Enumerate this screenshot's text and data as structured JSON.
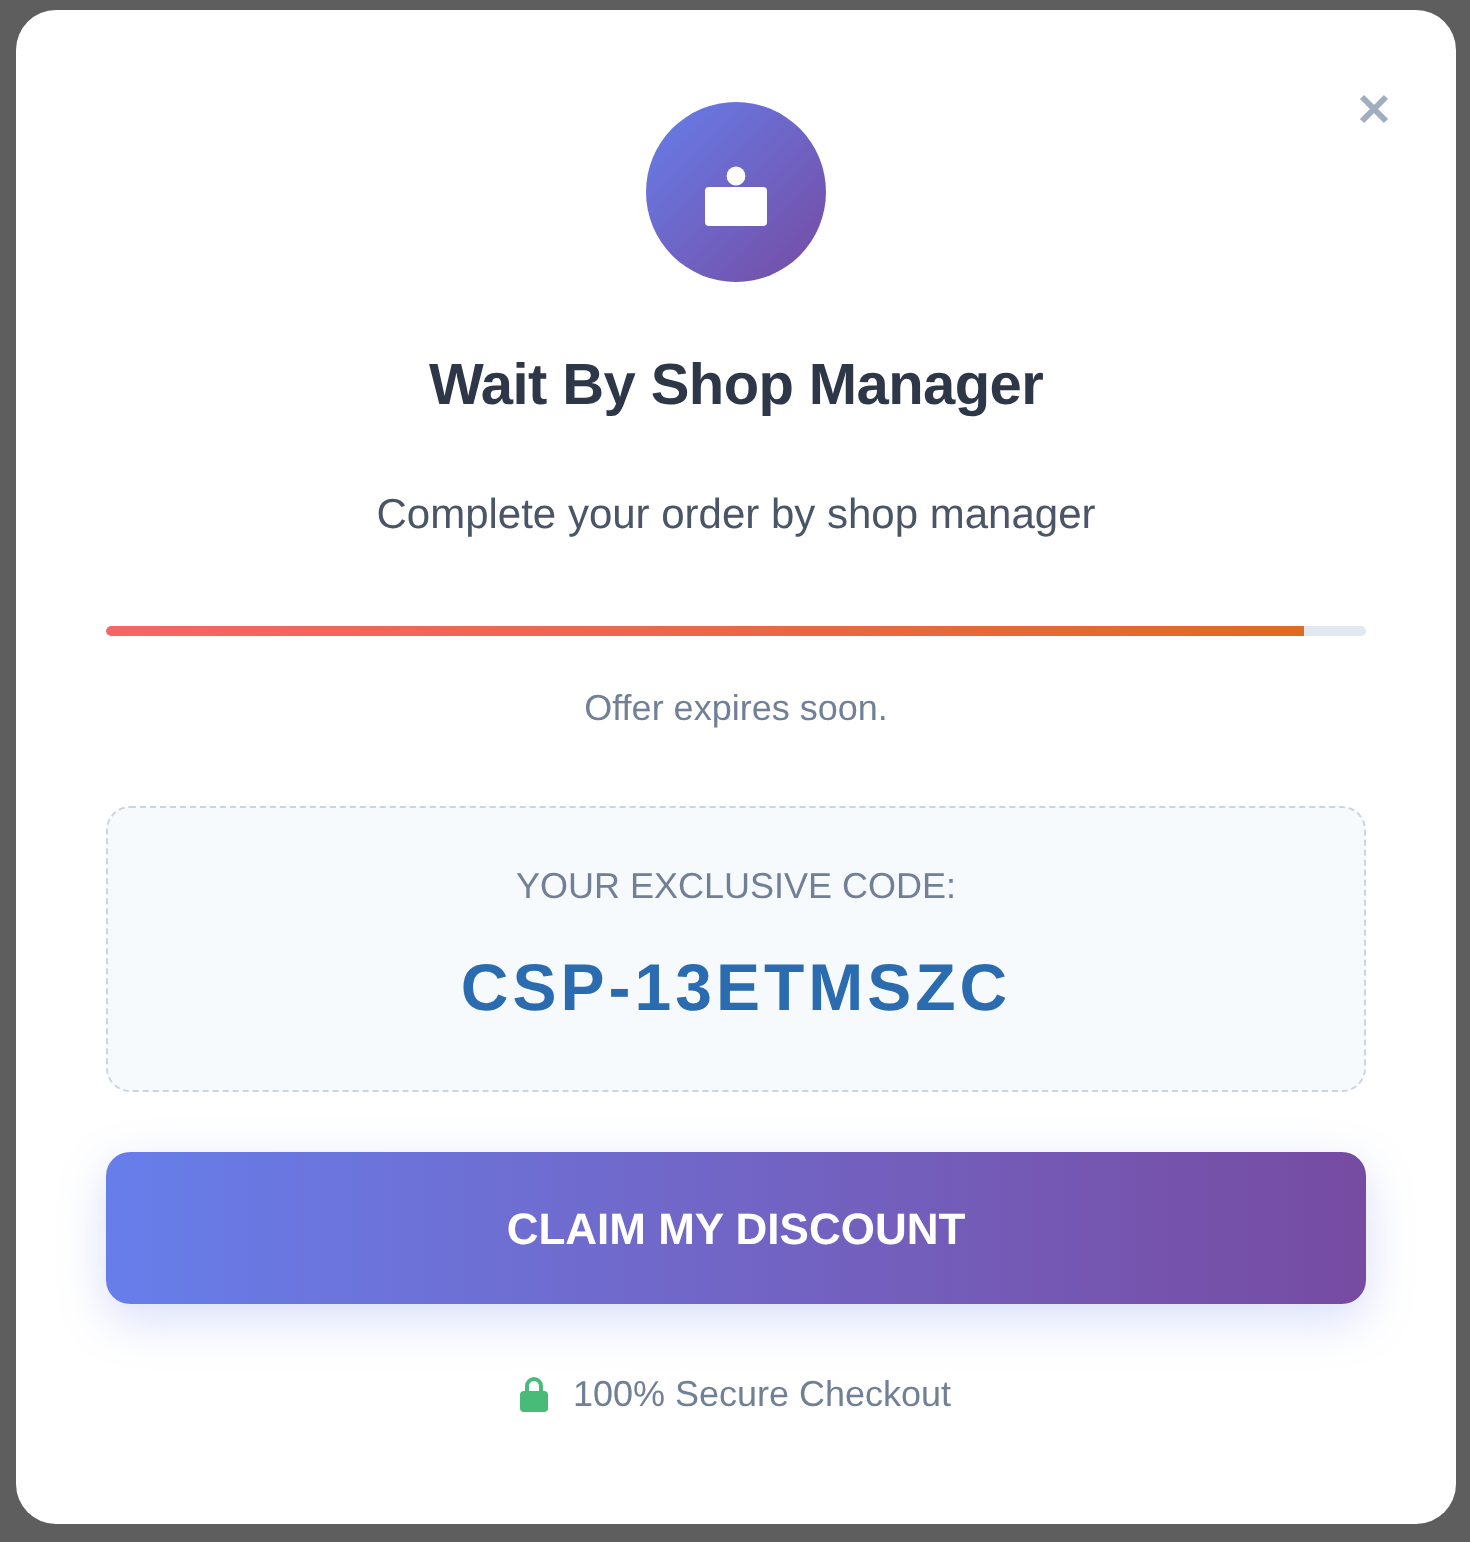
{
  "dialog": {
    "title": "Wait By Shop Manager",
    "subtitle": "Complete your order by shop manager",
    "timer": {
      "level": 0.95,
      "caption": "Offer expires soon."
    },
    "code_box": {
      "label": "YOUR EXCLUSIVE CODE:",
      "code": "CSP-13ETMSZC"
    },
    "button": {
      "label": "CLAIM MY DISCOUNT"
    },
    "footer": {
      "text": "100% Secure Checkout"
    }
  }
}
